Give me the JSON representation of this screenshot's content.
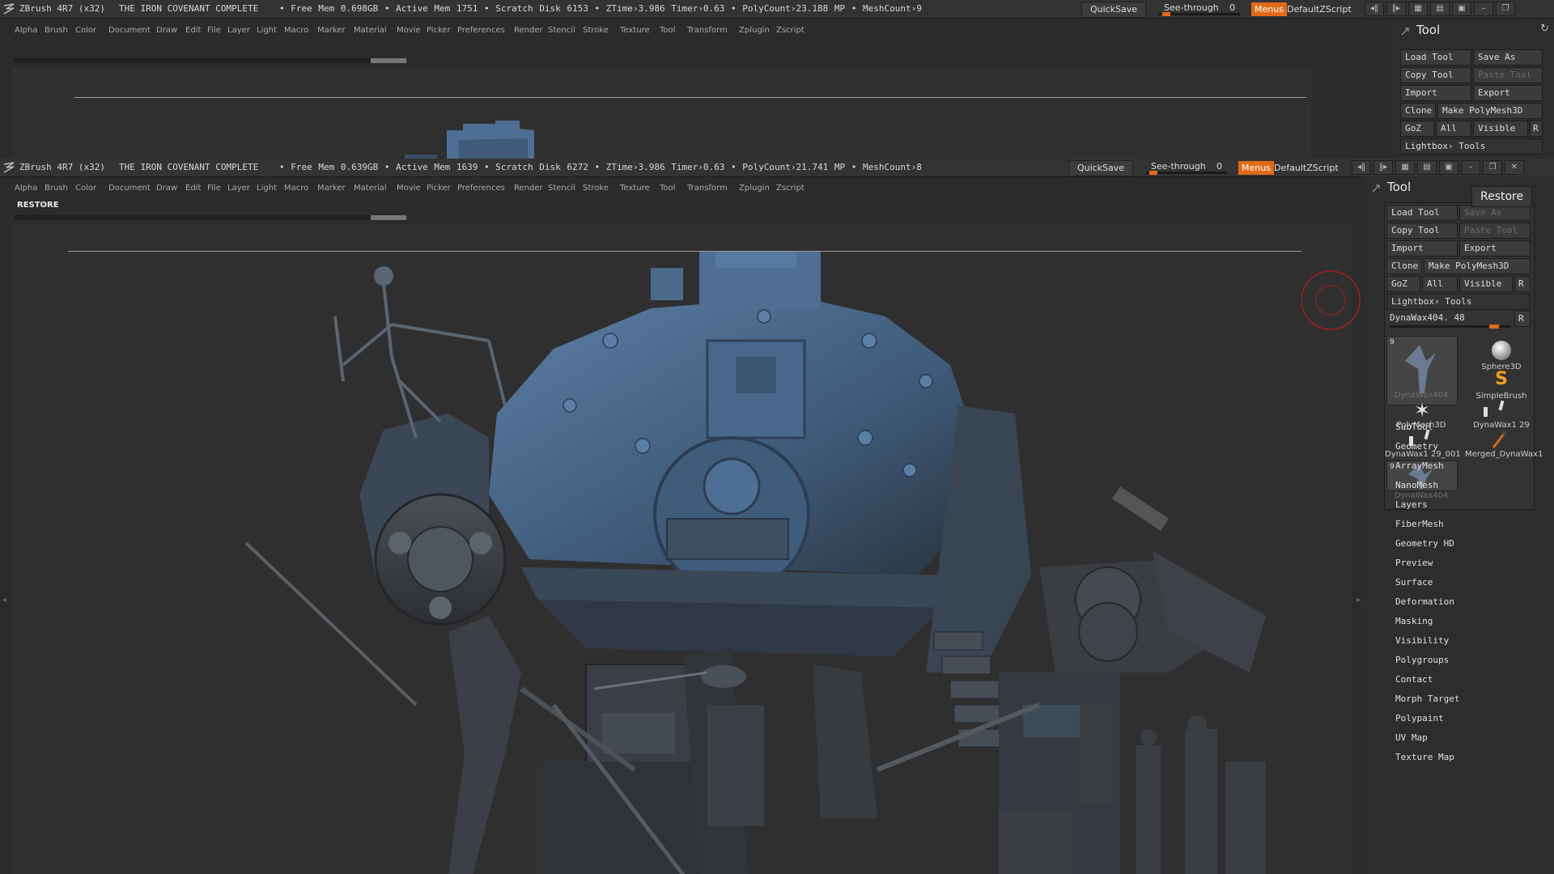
{
  "app": {
    "name": "ZBrush 4R7 (x32)",
    "project": "THE IRON COVENANT COMPLETE"
  },
  "back_window": {
    "stats": "• Free Mem 0.698GB • Active Mem 1751 • Scratch Disk 6153 • ZTime›3.986 Timer›0.63 • PolyCount›23.188 MP • MeshCount›9"
  },
  "front_window": {
    "stats": "• Free Mem 0.639GB • Active Mem 1639 • Scratch Disk 6272 • ZTime›3.986 Timer›0.63 • PolyCount›21.741 MP • MeshCount›8",
    "restore_label": "RESTORE",
    "tooltip": "Restore"
  },
  "titlebar": {
    "quicksave": "QuickSave",
    "see_through_label": "See-through",
    "see_through_value": "0",
    "see_through_level": 0,
    "menus": "Menus",
    "script": "DefaultZScript"
  },
  "menus": [
    "Alpha",
    "Brush",
    "Color",
    "Document",
    "Draw",
    "Edit",
    "File",
    "Layer",
    "Light",
    "Macro",
    "Marker",
    "Material",
    "Movie",
    "Picker",
    "Preferences",
    "Render",
    "Stencil",
    "Stroke",
    "Texture",
    "Tool",
    "Transform",
    "Zplugin",
    "Zscript"
  ],
  "tool_panel": {
    "title": "Tool",
    "load_tool": "Load Tool",
    "save_as": "Save As",
    "copy_tool": "Copy Tool",
    "paste_tool": "Paste Tool",
    "import": "Import",
    "export": "Export",
    "clone": "Clone",
    "make_polymesh": "Make PolyMesh3D",
    "goz": "GoZ",
    "all": "All",
    "visible": "Visible",
    "r": "R",
    "lightbox_tools": "Lightbox› Tools",
    "current_tool": "DynaWax404. 48",
    "current_tool_level": 0.86,
    "thumbs": [
      {
        "num": "9",
        "name": "DynaWax404"
      },
      {
        "name": "Sphere3D"
      },
      {
        "name": "SimpleBrush"
      },
      {
        "name": "PolyMesh3D"
      },
      {
        "name": "DynaWax1 29"
      },
      {
        "name": "DynaWax1 29_001"
      },
      {
        "name": "Merged_DynaWax1"
      },
      {
        "num": "9",
        "name": "DynaWax404"
      }
    ],
    "subpalettes": [
      "SubTool",
      "Geometry",
      "ArrayMesh",
      "NanoMesh",
      "Layers",
      "FiberMesh",
      "Geometry HD",
      "Preview",
      "Surface",
      "Deformation",
      "Masking",
      "Visibility",
      "Polygroups",
      "Contact",
      "Morph Target",
      "Polypaint",
      "UV Map",
      "Texture Map"
    ]
  },
  "colors": {
    "accent": "#e06a18",
    "background": "#2b2b2b",
    "model_blue": "#4d6f93"
  }
}
